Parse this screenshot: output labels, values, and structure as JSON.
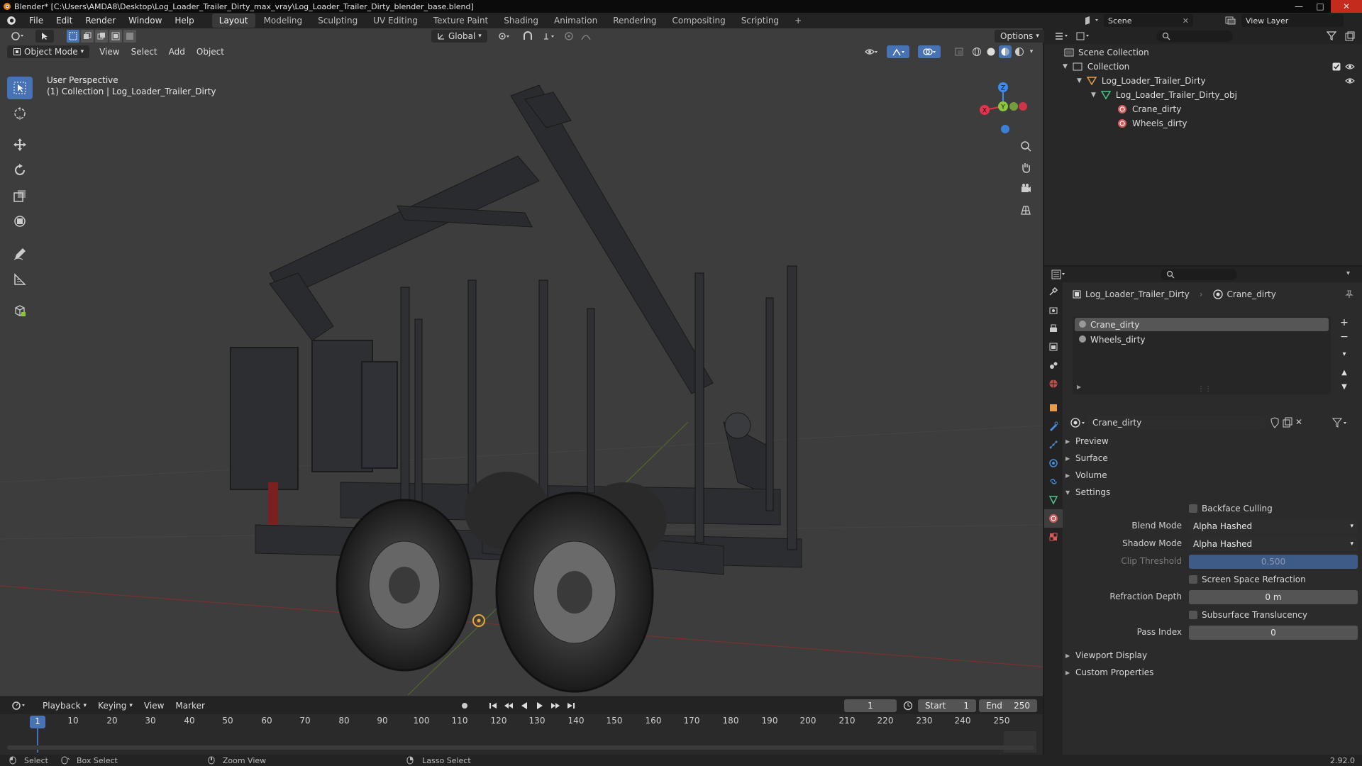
{
  "title_bar": {
    "text": "Blender* [C:\\Users\\AMDA8\\Desktop\\Log_Loader_Trailer_Dirty_max_vray\\Log_Loader_Trailer_Dirty_blender_base.blend]"
  },
  "menu": {
    "items": [
      "File",
      "Edit",
      "Render",
      "Window",
      "Help"
    ]
  },
  "workspaces": {
    "items": [
      "Layout",
      "Modeling",
      "Sculpting",
      "UV Editing",
      "Texture Paint",
      "Shading",
      "Animation",
      "Rendering",
      "Compositing",
      "Scripting"
    ],
    "active": "Layout"
  },
  "scene": {
    "name": "Scene",
    "view_layer": "View Layer"
  },
  "viewport": {
    "mode": "Object Mode",
    "menus": [
      "View",
      "Select",
      "Add",
      "Object"
    ],
    "orientation": "Global",
    "options_label": "Options",
    "overlay_line1": "User Perspective",
    "overlay_line2": "(1) Collection | Log_Loader_Trailer_Dirty",
    "gizmo_axes": {
      "x": "X",
      "y": "Y",
      "z": "Z"
    }
  },
  "outliner": {
    "rows": [
      "Scene Collection",
      "Collection",
      "Log_Loader_Trailer_Dirty",
      "Log_Loader_Trailer_Dirty_obj",
      "Crane_dirty",
      "Wheels_dirty"
    ]
  },
  "properties": {
    "breadcrumb_object": "Log_Loader_Trailer_Dirty",
    "breadcrumb_material": "Crane_dirty",
    "slots": [
      "Crane_dirty",
      "Wheels_dirty"
    ],
    "material_name": "Crane_dirty",
    "panels": {
      "preview": "Preview",
      "surface": "Surface",
      "volume": "Volume",
      "settings": "Settings",
      "viewport_display": "Viewport Display",
      "custom_properties": "Custom Properties"
    },
    "settings": {
      "backface_culling": "Backface Culling",
      "blend_mode_label": "Blend Mode",
      "blend_mode_value": "Alpha Hashed",
      "shadow_mode_label": "Shadow Mode",
      "shadow_mode_value": "Alpha Hashed",
      "clip_threshold_label": "Clip Threshold",
      "clip_threshold_value": "0.500",
      "ssr_label": "Screen Space Refraction",
      "refraction_depth_label": "Refraction Depth",
      "refraction_depth_value": "0 m",
      "subsurface_label": "Subsurface Translucency",
      "pass_index_label": "Pass Index",
      "pass_index_value": "0"
    }
  },
  "timeline": {
    "menus": [
      "Playback",
      "Keying",
      "View",
      "Marker"
    ],
    "current_frame": "1",
    "start_label": "Start",
    "start_value": "1",
    "end_label": "End",
    "end_value": "250",
    "ruler": [
      "1",
      "10",
      "20",
      "30",
      "40",
      "50",
      "60",
      "70",
      "80",
      "90",
      "100",
      "110",
      "120",
      "130",
      "140",
      "150",
      "160",
      "170",
      "180",
      "190",
      "200",
      "210",
      "220",
      "230",
      "240",
      "250"
    ]
  },
  "status_bar": {
    "select": "Select",
    "box_select": "Box Select",
    "zoom_view": "Zoom View",
    "lasso_select": "Lasso Select",
    "version": "2.92.0"
  },
  "colors": {
    "accent": "#4772b3",
    "axis_x": "#e7334b",
    "axis_y": "#8cc63e",
    "axis_z": "#3c8cf0",
    "viewport_bg": "#3d3d3d"
  }
}
